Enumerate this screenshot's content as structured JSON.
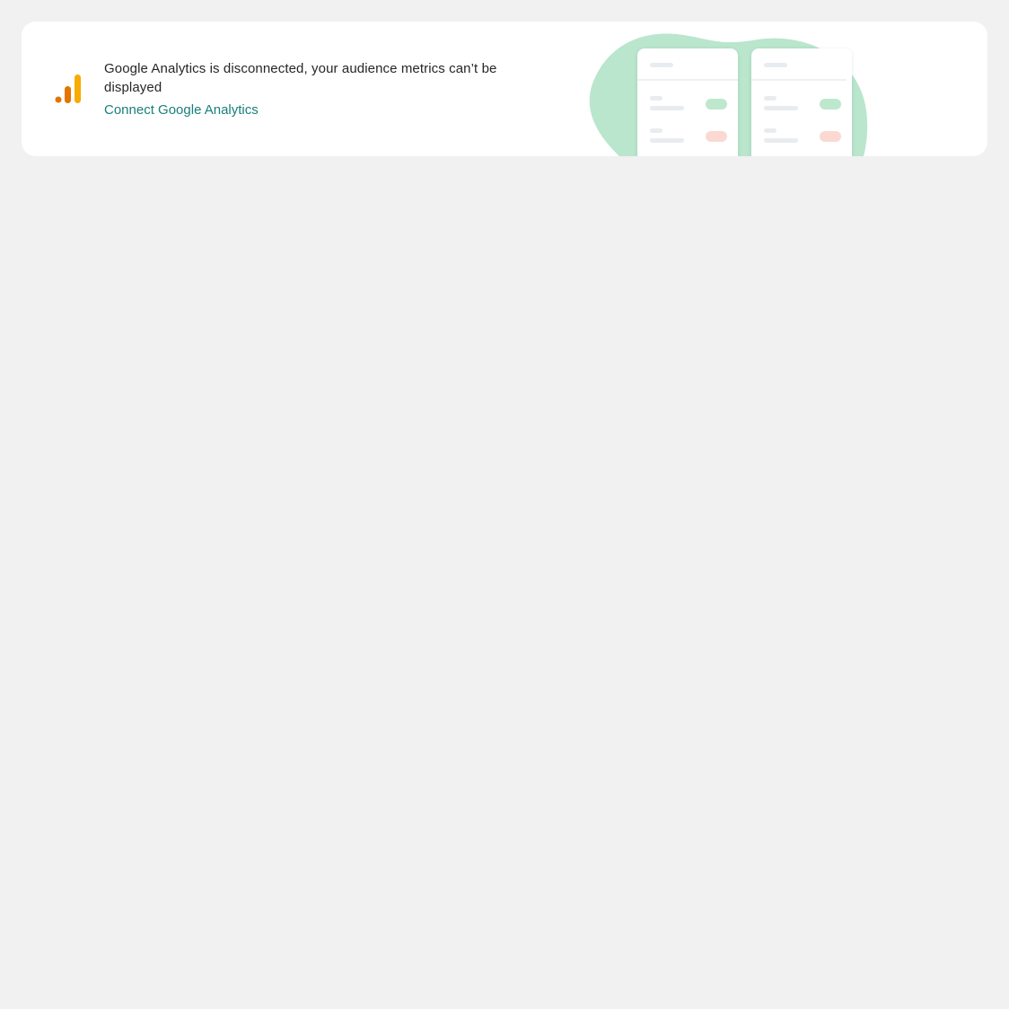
{
  "banner": {
    "message": "Google Analytics is disconnected, your audience metrics can’t be displayed",
    "link_label": "Connect Google Analytics",
    "logo_icon": "google-analytics-icon",
    "illustration": "metrics-cards-illustration"
  },
  "colors": {
    "page_background": "#f1f1f1",
    "card_background": "#ffffff",
    "link": "#18807a",
    "blob": "#b9e6cc",
    "badge_positive": "#bde8cd",
    "badge_negative": "#fbd9d2",
    "logo_orange_dark": "#e37400",
    "logo_orange_light": "#f9ab00"
  }
}
